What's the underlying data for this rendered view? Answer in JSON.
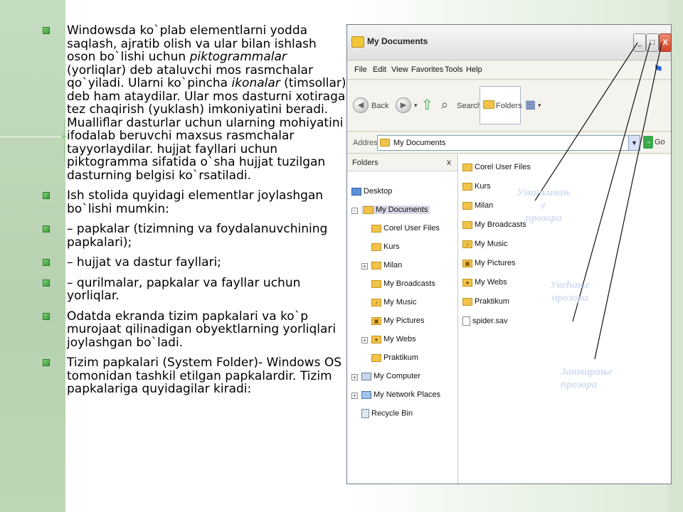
{
  "bullets": [
    {
      "parts": [
        {
          "t": "Windowsda ko`plab elementlarni yodda saqlash, ajratib olish va ular bilan ishlash oson bo`lishi uchun ",
          "i": false
        },
        {
          "t": "piktogrammalar",
          "i": true
        },
        {
          "t": " (yorliqlar) deb ataluvchi mos rasmchalar qo`yiladi. Ularni ko`pincha ",
          "i": false
        },
        {
          "t": "ikonalar",
          "i": true
        },
        {
          "t": " (timsollar) deb ham ataydilar. Ular mos dasturni xotiraga tez chaqirish (yuklash) imkoniyatini beradi. Mualliflar dasturlar uchun ularning mohiyatini ifodalab beruvchi maxsus rasmchalar tayyorlaydilar. hujjat fayllari uchun piktogramma sifatida o`sha hujjat tuzilgan dasturning belgisi ko`rsatiladi.",
          "i": false
        }
      ]
    },
    {
      "parts": [
        {
          "t": "Ish stolida quyidagi elementlar joylashgan bo`lishi mumkin:",
          "i": false
        }
      ]
    },
    {
      "parts": [
        {
          "t": "–        papkalar (tizimning va foydalanuvchining papkalari);",
          "i": false
        }
      ]
    },
    {
      "parts": [
        {
          "t": "–        hujjat va dastur fayllari;",
          "i": false
        }
      ]
    },
    {
      "parts": [
        {
          "t": "–        qurilmalar, papkalar va fayllar uchun yorliqlar.",
          "i": false
        }
      ]
    },
    {
      "parts": [
        {
          "t": "Odatda ekranda tizim papkalari va ko`p murojaat qilinadigan  obyektlarning yorliqlari  joylashgan bo`ladi.",
          "i": false
        }
      ]
    },
    {
      "parts": [
        {
          "t": "Tizim papkalari (System Folder)- Windows OS tomonidan tashkil etilgan papkalardir. Tizim papkalariga quyidagilar kiradi:",
          "i": false
        }
      ]
    }
  ],
  "window": {
    "title": "My Documents",
    "title_buttons": {
      "minimize": "_",
      "maximize": "□",
      "close": "X"
    },
    "menu": [
      "File",
      "Edit",
      "View",
      "Favorites",
      "Tools",
      "Help"
    ],
    "toolbar": {
      "back": "Back",
      "search": "Search",
      "folders": "Folders"
    },
    "address": {
      "label": "Address",
      "value": "My Documents",
      "go": "Go"
    },
    "tree": {
      "header": "Folders",
      "close": "x",
      "items": [
        {
          "label": "Desktop",
          "icon": "desktop-icon"
        },
        {
          "label": "My Documents",
          "icon": "folder-icon"
        },
        {
          "label": "Corel User Files",
          "icon": "folder-icon"
        },
        {
          "label": "Kurs",
          "icon": "folder-icon"
        },
        {
          "label": "Milan",
          "icon": "folder-icon"
        },
        {
          "label": "My Broadcasts",
          "icon": "folder-icon"
        },
        {
          "label": "My Music",
          "icon": "music-folder-icon"
        },
        {
          "label": "My Pictures",
          "icon": "pictures-folder-icon"
        },
        {
          "label": "My Webs",
          "icon": "webs-folder-icon"
        },
        {
          "label": "Praktikum",
          "icon": "folder-icon"
        },
        {
          "label": "My Computer",
          "icon": "computer-icon"
        },
        {
          "label": "My Network Places",
          "icon": "network-icon"
        },
        {
          "label": "Recycle Bin",
          "icon": "recycle-bin-icon"
        }
      ]
    },
    "files": [
      {
        "label": "Corel User Files",
        "icon": "folder-icon"
      },
      {
        "label": "Kurs",
        "icon": "folder-icon"
      },
      {
        "label": "Milan",
        "icon": "folder-icon"
      },
      {
        "label": "My Broadcasts",
        "icon": "folder-icon"
      },
      {
        "label": "My Music",
        "icon": "music-folder-icon"
      },
      {
        "label": "My Pictures",
        "icon": "pictures-folder-icon"
      },
      {
        "label": "My Webs",
        "icon": "webs-folder-icon"
      },
      {
        "label": "Praktikum",
        "icon": "folder-icon"
      },
      {
        "label": "spider.sav",
        "icon": "file-icon"
      }
    ]
  },
  "annotations": {
    "minimize": [
      "Уманьивањ",
      "е",
      "прозора"
    ],
    "maximize": [
      "Увећање",
      "прозора"
    ],
    "close": [
      "Затварање",
      "прозора"
    ]
  },
  "colors": {
    "bullet": "#3a9a36",
    "annotation": "#c3d2eb",
    "folder": "#f2c34a"
  }
}
